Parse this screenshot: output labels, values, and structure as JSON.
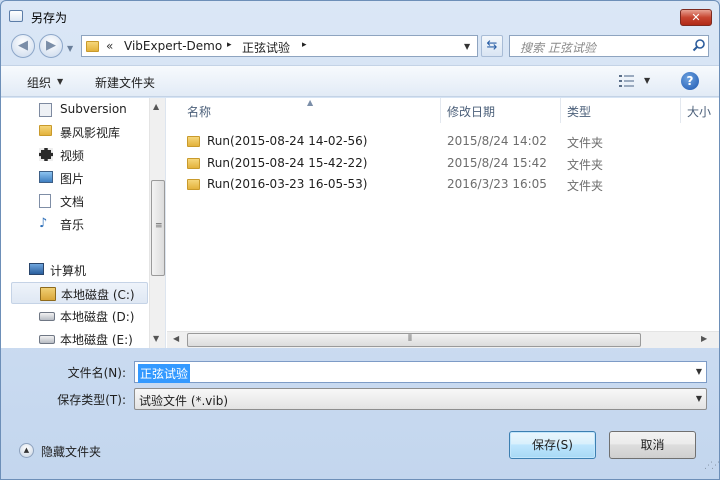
{
  "window": {
    "title": "另存为",
    "close_label": "✕"
  },
  "address": {
    "overflow": "«",
    "crumbs": [
      "VibExpert-Demo",
      "正弦试验"
    ],
    "sep": "▸"
  },
  "search": {
    "placeholder": "搜索 正弦试验"
  },
  "toolbar": {
    "organize_label": "组织",
    "new_folder_label": "新建文件夹",
    "help_label": "?"
  },
  "nav_pane": {
    "items": [
      {
        "label": "Subversion",
        "icon": "svn-icon"
      },
      {
        "label": "暴风影视库",
        "icon": "folder-icon"
      },
      {
        "label": "视频",
        "icon": "video-icon"
      },
      {
        "label": "图片",
        "icon": "pictures-icon"
      },
      {
        "label": "文档",
        "icon": "documents-icon"
      },
      {
        "label": "音乐",
        "icon": "music-icon"
      }
    ],
    "computer": {
      "label": "计算机",
      "drives": [
        {
          "label": "本地磁盘 (C:)",
          "selected": true
        },
        {
          "label": "本地磁盘 (D:)",
          "selected": false
        },
        {
          "label": "本地磁盘 (E:)",
          "selected": false
        }
      ]
    }
  },
  "file_list": {
    "columns": [
      "名称",
      "修改日期",
      "类型",
      "大小"
    ],
    "rows": [
      {
        "name": "Run(2015-08-24 14-02-56)",
        "date": "2015/8/24 14:02",
        "type": "文件夹"
      },
      {
        "name": "Run(2015-08-24 15-42-22)",
        "date": "2015/8/24 15:42",
        "type": "文件夹"
      },
      {
        "name": "Run(2016-03-23 16-05-53)",
        "date": "2016/3/23 16:05",
        "type": "文件夹"
      }
    ]
  },
  "form": {
    "filename_label": "文件名(N):",
    "filename_value": "正弦试验",
    "filetype_label": "保存类型(T):",
    "filetype_value": "试验文件 (*.vib)"
  },
  "footer": {
    "hide_folders_label": "隐藏文件夹",
    "save_label": "保存(S)",
    "cancel_label": "取消"
  }
}
